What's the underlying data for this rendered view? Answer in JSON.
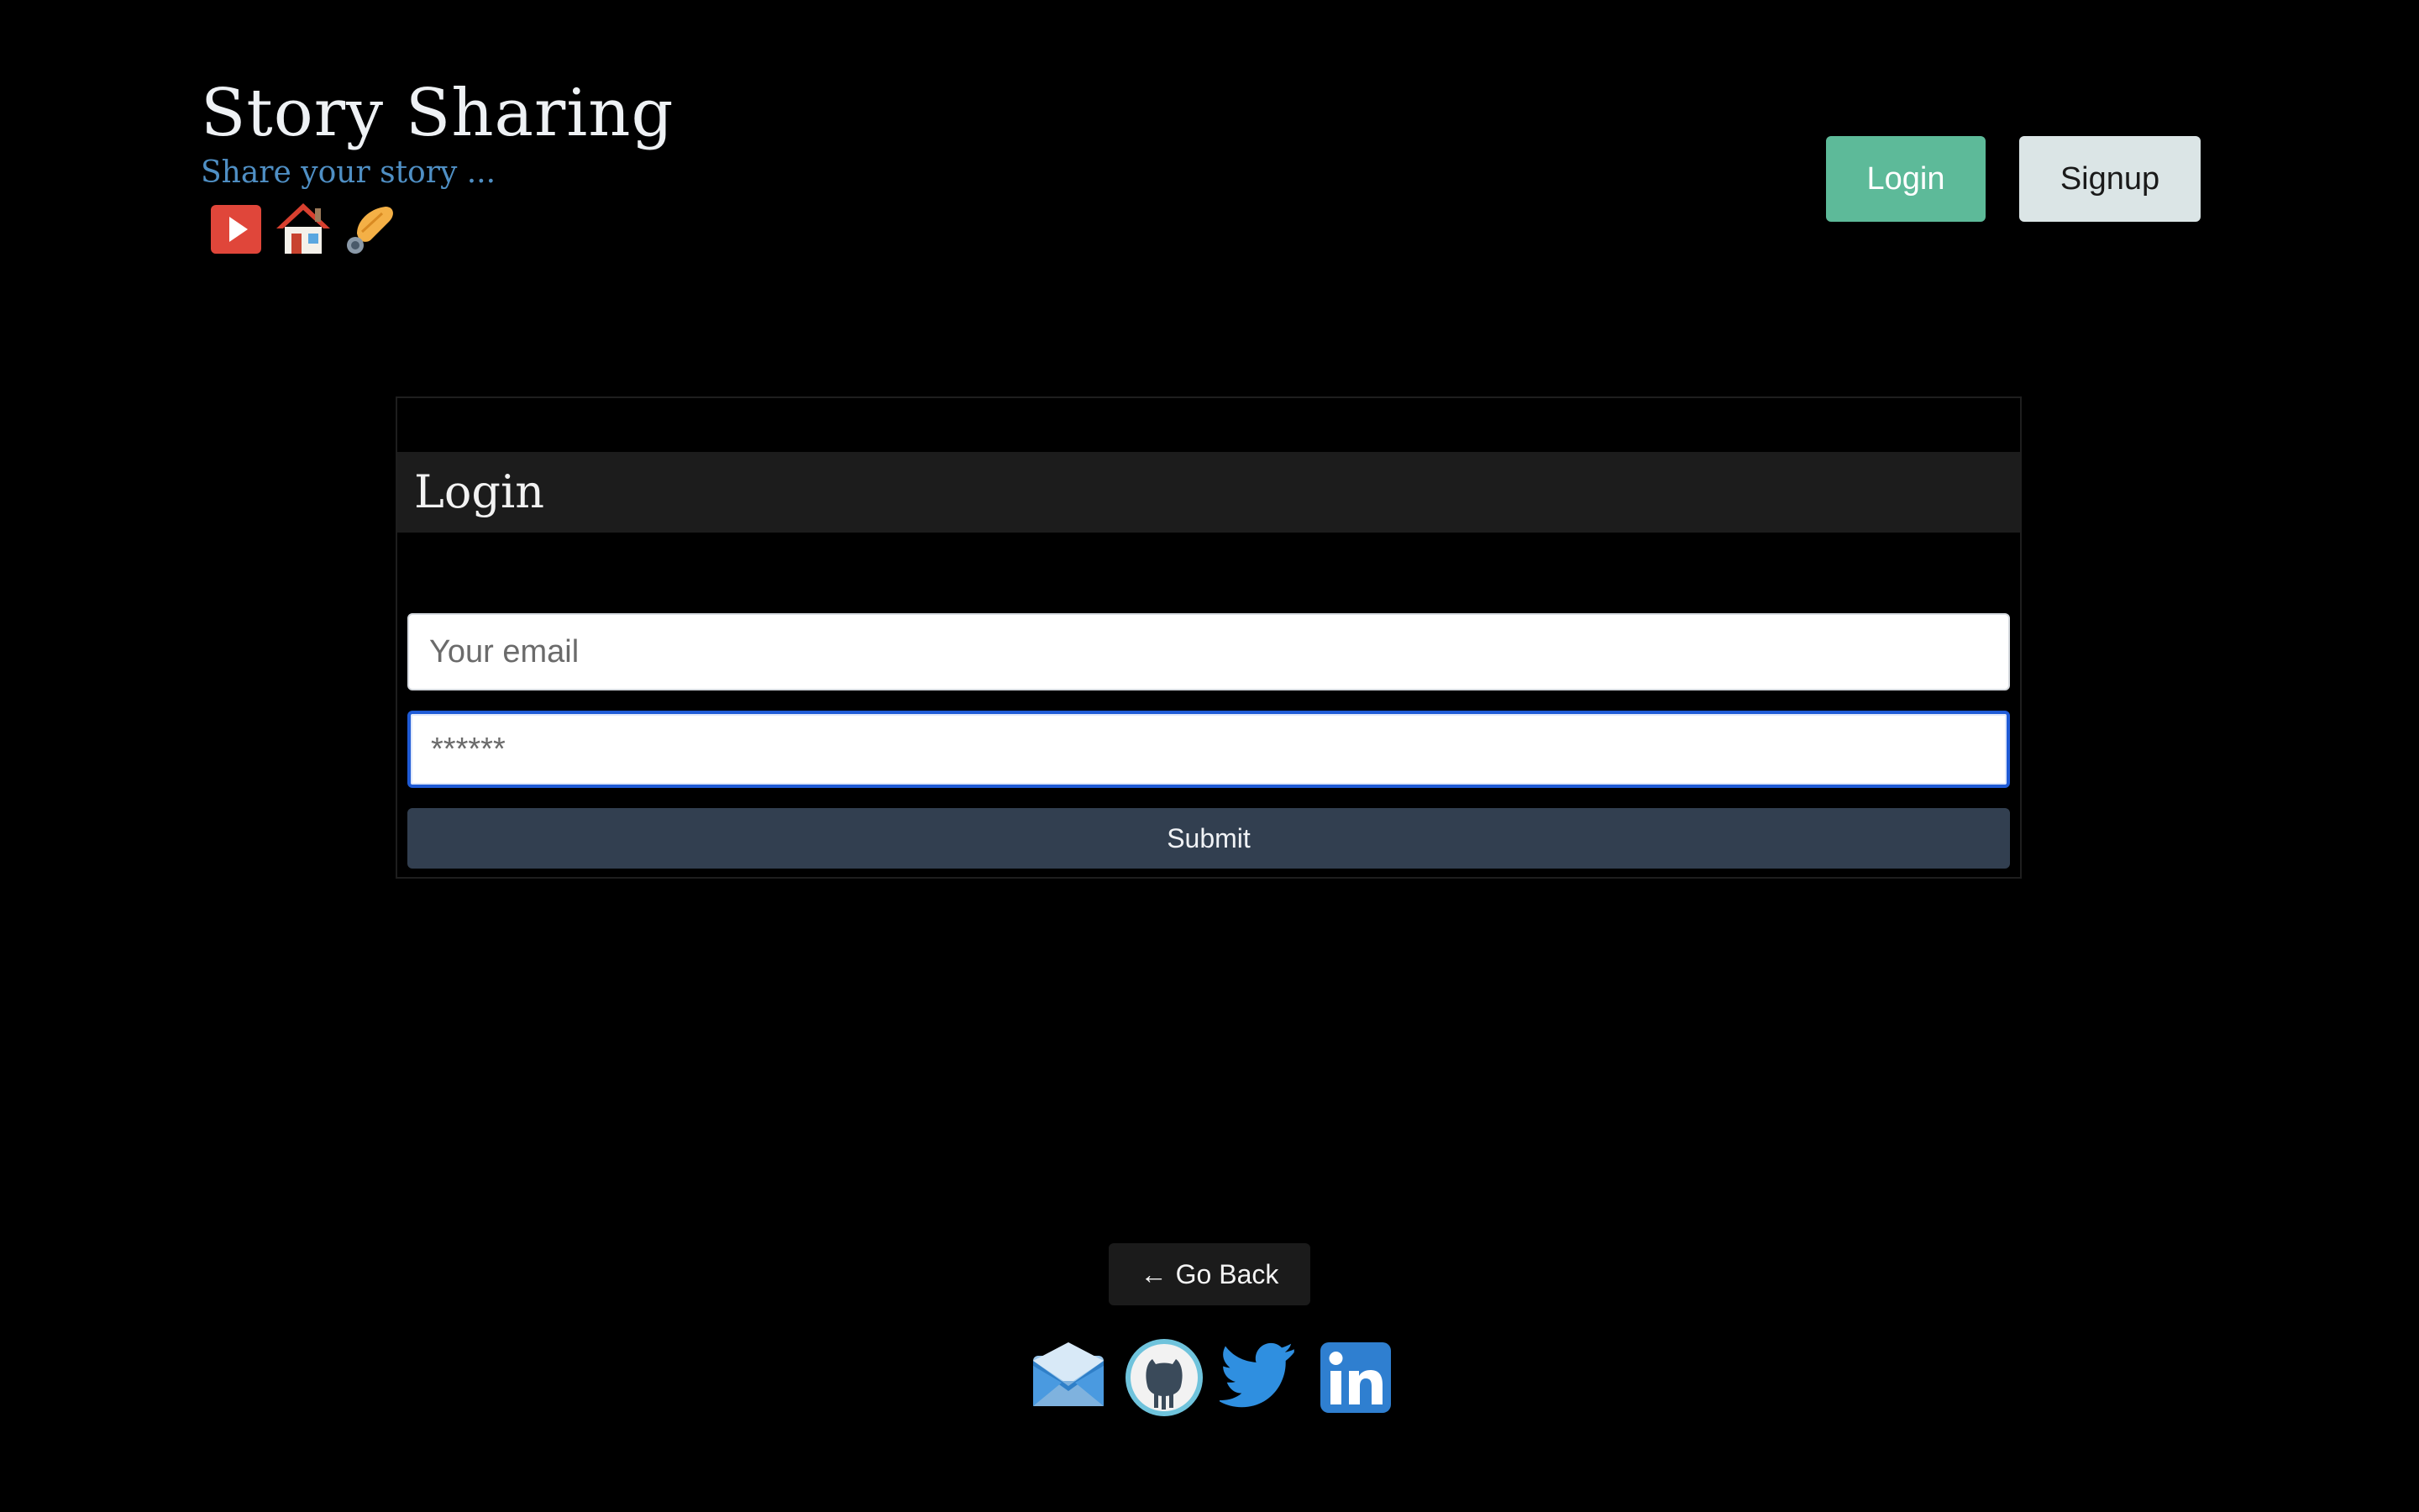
{
  "header": {
    "title": "Story Sharing",
    "subtitle": "Share your story ...",
    "icons": [
      "play-button-icon",
      "house-icon",
      "writing-hand-icon"
    ],
    "login_label": "Login",
    "signup_label": "Signup"
  },
  "login_card": {
    "title": "Login",
    "email_placeholder": "Your email",
    "password_placeholder": "******",
    "submit_label": "Submit"
  },
  "footer": {
    "go_back_arrow": "←",
    "go_back_label": "Go Back",
    "social_icons": [
      "email-icon",
      "github-icon",
      "twitter-icon",
      "linkedin-icon"
    ]
  },
  "colors": {
    "background": "#000000",
    "login_button": "#5dba99",
    "signup_button": "#dbe5e6",
    "submit_button": "#323f50",
    "subtitle": "#4f8fc4",
    "focus_ring": "#1f5bd6"
  }
}
